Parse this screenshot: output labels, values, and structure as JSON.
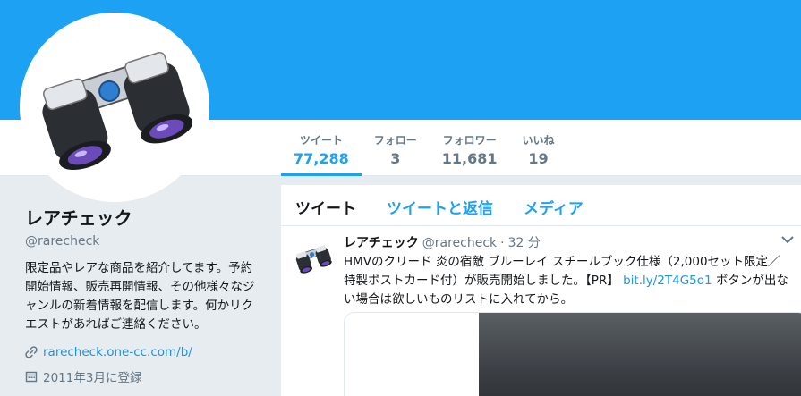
{
  "stats": [
    {
      "label": "ツイート",
      "value": "77,288",
      "active": true
    },
    {
      "label": "フォロー",
      "value": "3"
    },
    {
      "label": "フォロワー",
      "value": "11,681"
    },
    {
      "label": "いいね",
      "value": "19"
    }
  ],
  "profile": {
    "name": "レアチェック",
    "handle": "@rarecheck",
    "bio": "限定品やレアな商品を紹介してます。予約開始情報、販売再開情報、その他様々なジャンルの新着情報を配信します。何かリクエストがあればご連絡ください。",
    "url": "rarecheck.one-cc.com/b/",
    "joined": "2011年3月に登録"
  },
  "tabs": [
    {
      "label": "ツイート",
      "active": true
    },
    {
      "label": "ツイートと返信"
    },
    {
      "label": "メディア"
    }
  ],
  "tweet": {
    "name": "レアチェック",
    "handle": "@rarecheck",
    "dot": "·",
    "time": "32 分",
    "text_before": "HMVのクリード 炎の宿敵 ブルーレイ スチールブック仕様（2,000セット限定／特製ポストカード付）が販売開始しました。【PR】",
    "link": "bit.ly/2T4G5o1",
    "text_after": "ボタンが出ない場合は欲しいものリストに入れてから。"
  },
  "colors": {
    "brand": "#1da1f2",
    "link": "#1b95e0",
    "muted": "#657786"
  }
}
